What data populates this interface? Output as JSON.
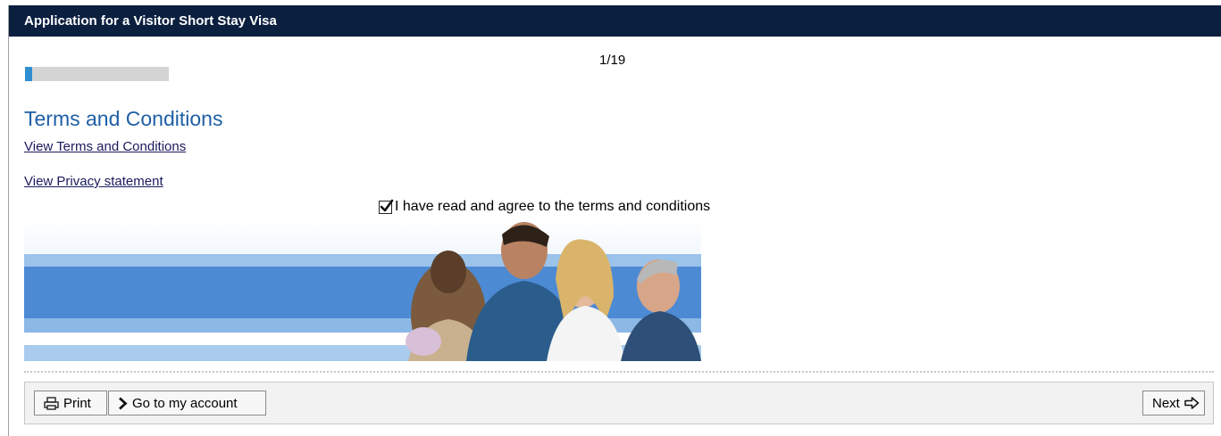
{
  "header": {
    "title": "Application for a Visitor Short Stay Visa"
  },
  "progress": {
    "page_label": "1/19",
    "current": 1,
    "total": 19
  },
  "section": {
    "title": "Terms and Conditions",
    "terms_link": "View Terms and Conditions",
    "privacy_link": "View Privacy statement",
    "agree_label": "I have read and agree to the terms and conditions",
    "agree_checked": true
  },
  "toolbar": {
    "print_label": "Print",
    "account_label": "Go to my account",
    "next_label": "Next"
  },
  "icons": {
    "print": "printer-icon",
    "account": "chevron-right-icon",
    "next": "arrow-right-icon",
    "checkbox": "checkmark-icon"
  },
  "colors": {
    "header_bg": "#0b1f3f",
    "title_blue": "#1f5fa5",
    "progress_fill": "#2f8fd0",
    "progress_track": "#d4d4d4"
  }
}
